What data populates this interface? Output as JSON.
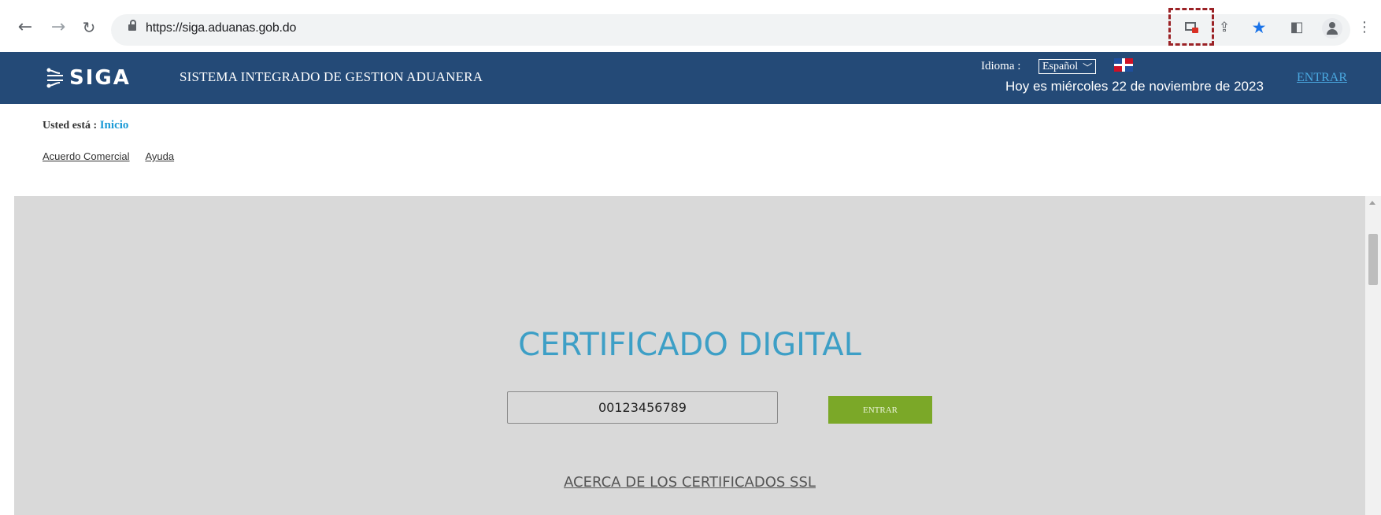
{
  "browser": {
    "url": "https://siga.aduanas.gob.do",
    "back_icon": "arrow-left-icon",
    "forward_icon": "arrow-right-icon",
    "reload_icon": "reload-icon",
    "bookmarked": true
  },
  "header": {
    "logo_text": "SIGA",
    "system_title": "SISTEMA INTEGRADO DE GESTION ADUANERA",
    "idioma_label": "Idioma :",
    "idioma_value": "Español",
    "date_text": "Hoy es miércoles 22 de noviembre de 2023",
    "login_link": "ENTRAR",
    "background_color": "#244a77"
  },
  "breadcrumb": {
    "prefix": "Usted está :",
    "current": "Inicio"
  },
  "links": {
    "acuerdo": "Acuerdo Comercial",
    "ayuda": "Ayuda"
  },
  "main": {
    "title": "CERTIFICADO DIGITAL",
    "input_value": "00123456789",
    "submit_label": "ENTRAR",
    "ssl_link": "ACERCA DE LOS CERTIFICADOS SSL",
    "title_color": "#3d9fc6",
    "button_color": "#7ba828"
  }
}
